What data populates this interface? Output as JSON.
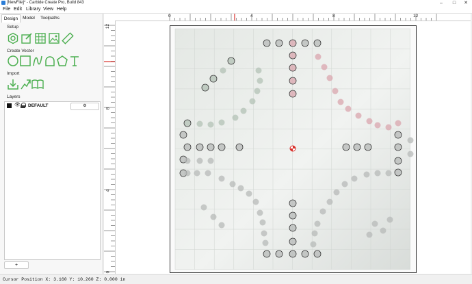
{
  "window": {
    "title": "[NewFile]* - Carbide Create Pro, Build 843",
    "controls": [
      "–",
      "□",
      "✕"
    ]
  },
  "menu": [
    "File",
    "Edit",
    "Library",
    "View",
    "Help"
  ],
  "tabs": [
    "Design",
    "Model",
    "Toolpaths"
  ],
  "active_tab": "Design",
  "sections": {
    "setup": "Setup",
    "create_vector": "Create Vector",
    "import": "Import",
    "layers": "Layers"
  },
  "setup_tools": [
    "gear-icon",
    "edit-icon",
    "table-icon",
    "image-icon",
    "ruler-icon"
  ],
  "vector_tools": [
    "circle-icon",
    "rectangle-icon",
    "curve-icon",
    "arch-icon",
    "polygon-icon",
    "text-icon"
  ],
  "import_tools": [
    "import-icon",
    "import-vector-icon",
    "library-icon"
  ],
  "layer": {
    "name": "DEFAULT",
    "color": "#111111",
    "settings_icon": "gear-icon"
  },
  "add_layer_label": "+",
  "rulers": {
    "x_labels": [
      "0",
      "4",
      "8",
      "12"
    ],
    "y_labels": [
      "12",
      "8",
      "4",
      "0"
    ]
  },
  "status_bar": "Cursor Position X: 3.160 Y: 10.260 Z: 0.000 in",
  "colors": {
    "origin_marker": "#d9302b",
    "cursor_marker": "#d9302b"
  }
}
